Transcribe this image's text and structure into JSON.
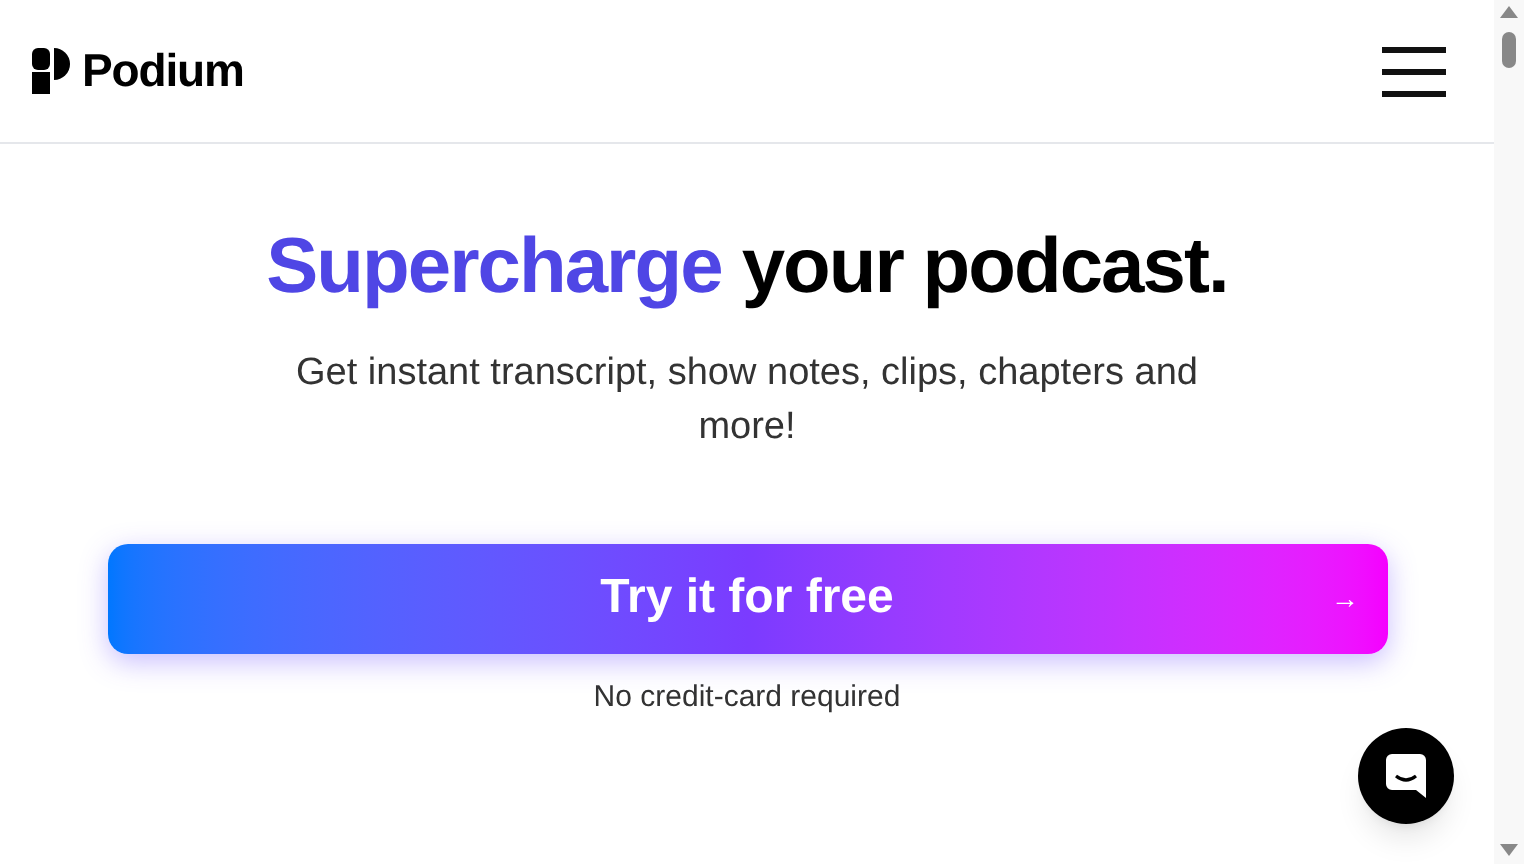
{
  "header": {
    "logo_text": "Podium"
  },
  "hero": {
    "headline_highlight": "Supercharge",
    "headline_rest": "your podcast.",
    "subtitle": "Get instant transcript, show notes, clips, chapters and more!"
  },
  "cta": {
    "label": "Try it for free",
    "arrow": "→",
    "note": "No credit-card required"
  }
}
